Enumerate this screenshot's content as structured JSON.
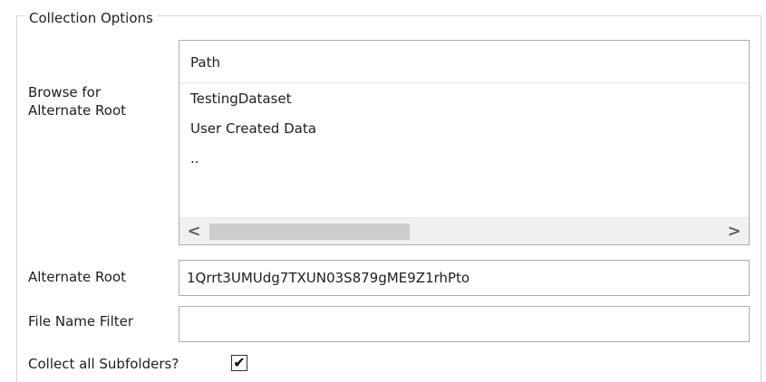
{
  "group": {
    "title": "Collection Options"
  },
  "browse": {
    "label_line1": "Browse for",
    "label_line2": "Alternate Root",
    "list_header": "Path",
    "items": [
      "TestingDataset",
      "User Created Data",
      ".."
    ],
    "scroll_left_glyph": "<",
    "scroll_right_glyph": ">"
  },
  "alternate_root": {
    "label": "Alternate Root",
    "value": "1Qrrt3UMUdg7TXUN03S879gME9Z1rhPto"
  },
  "file_name_filter": {
    "label": "File Name Filter",
    "value": ""
  },
  "collect_subfolders": {
    "label": "Collect all Subfolders?",
    "checked": true,
    "check_glyph": "✔"
  }
}
